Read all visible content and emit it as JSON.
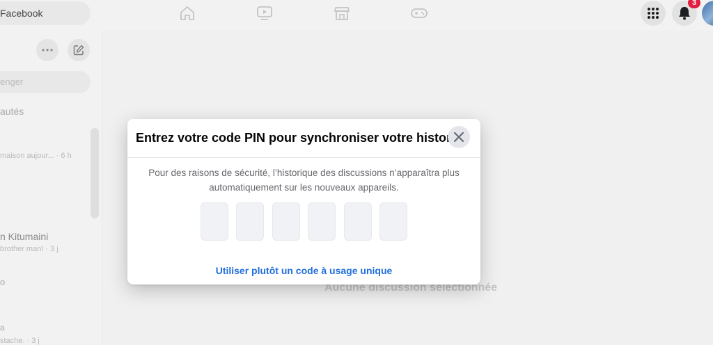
{
  "topbar": {
    "search_label": "Facebook",
    "notification_count": "3",
    "nav_icons": [
      "home-icon",
      "watch-icon",
      "marketplace-icon",
      "gaming-icon"
    ]
  },
  "sidebar": {
    "search_placeholder": "enger",
    "section_label": "autés",
    "conversations": [
      {
        "preview": "maison aujour... · 6 h"
      },
      {
        "name": "n Kitumaini",
        "preview": "brother man! · 3 j"
      },
      {
        "name": "o"
      },
      {
        "name": "a",
        "preview": "stache. · 3 j"
      }
    ]
  },
  "main": {
    "empty_label": "Aucune discussion sélectionnée"
  },
  "dialog": {
    "title": "Entrez votre code PIN pour synchroniser votre histori…",
    "description": "Pour des raisons de sécurité, l’historique des discussions n’apparaîtra plus automatiquement sur les nouveaux appareils.",
    "pin_length": 6,
    "otp_link": "Utiliser plutôt un code à usage unique"
  },
  "colors": {
    "accent": "#216fdb",
    "badge": "#e41e3f"
  }
}
